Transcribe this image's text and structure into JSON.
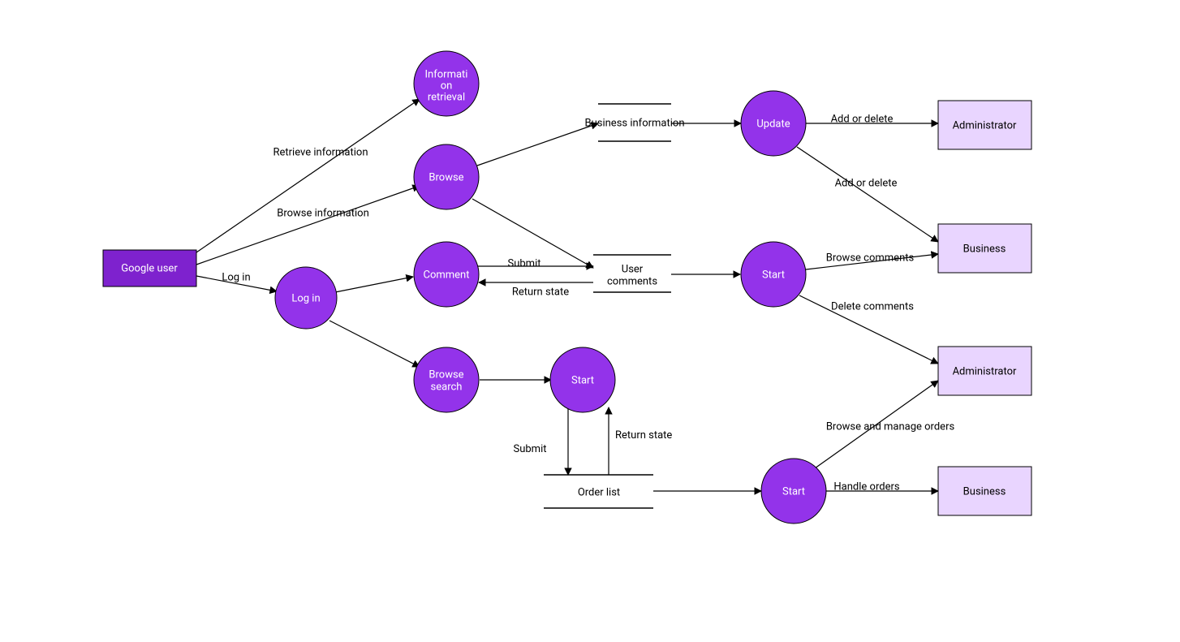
{
  "nodes": {
    "google_user": "Google user",
    "login": "Log in",
    "info_retrieval_l1": "Informati",
    "info_retrieval_l2": "on",
    "info_retrieval_l3": "retrieval",
    "browse": "Browse",
    "comment": "Comment",
    "browse_search_l1": "Browse",
    "browse_search_l2": "search",
    "start_search": "Start",
    "update": "Update",
    "start_comments": "Start",
    "start_orders": "Start",
    "admin_top": "Administrator",
    "business_top": "Business",
    "admin_bottom": "Administrator",
    "business_bottom": "Business"
  },
  "stores": {
    "business_info": "Business information",
    "user_comments_l1": "User",
    "user_comments_l2": "comments",
    "order_list": "Order list"
  },
  "edges": {
    "retrieve_info": "Retrieve information",
    "browse_info": "Browse information",
    "login_edge": "Log in",
    "submit_comment": "Submit",
    "return_state_comment": "Return state",
    "submit_order": "Submit",
    "return_state_order": "Return state",
    "add_delete_admin": "Add or delete",
    "add_delete_business": "Add or delete",
    "browse_comments": "Browse comments",
    "delete_comments": "Delete comments",
    "browse_manage_orders": "Browse and manage orders",
    "handle_orders": "Handle orders"
  }
}
